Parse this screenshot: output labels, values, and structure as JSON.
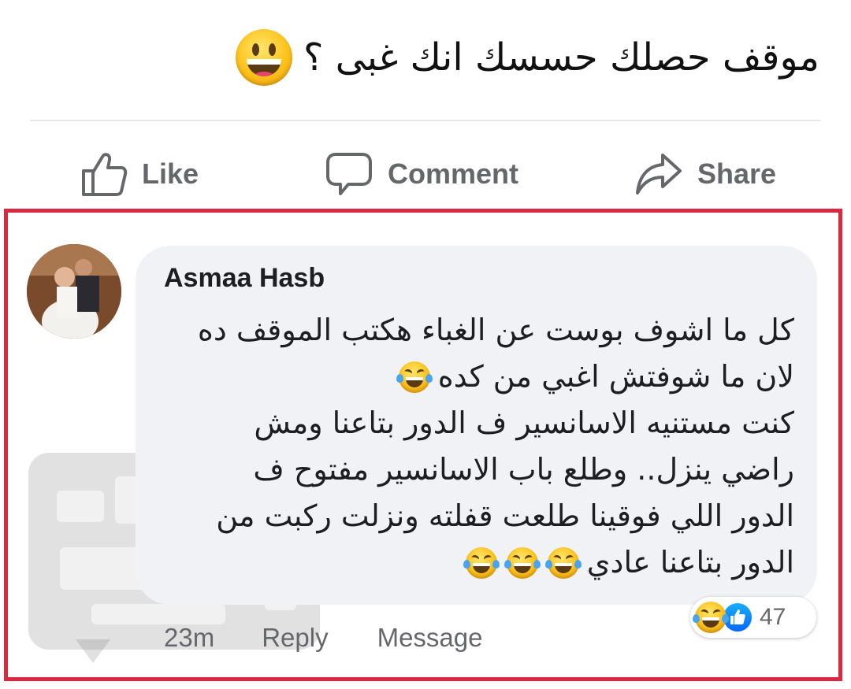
{
  "post": {
    "title": "موقف حصلك حسسك انك غبى ؟",
    "title_emoji": "grinning-face-emoji"
  },
  "actions": {
    "like_label": "Like",
    "comment_label": "Comment",
    "share_label": "Share"
  },
  "comment": {
    "author": "Asmaa Hasb",
    "lines": [
      "كل ما اشوف بوست عن الغباء هكتب الموقف ده",
      "لان ما شوفتش اغبي من كده",
      "كنت مستنيه الاسانسير ف الدور بتاعنا ومش",
      "راضي ينزل.. وطلع باب الاسانسير مفتوح ف",
      "الدور اللي فوقينا طلعت قفلته ونزلت ركبت من",
      "الدور بتاعنا عادي"
    ],
    "time": "23m",
    "reply_label": "Reply",
    "message_label": "Message",
    "reaction_count": "47",
    "reaction_icons": [
      "laughing-emoji",
      "like-icon"
    ]
  },
  "colors": {
    "highlight_frame": "#d9283f",
    "bubble_bg": "#f0f2f5",
    "action_text": "#65676b",
    "like_blue": "#0866ff"
  }
}
